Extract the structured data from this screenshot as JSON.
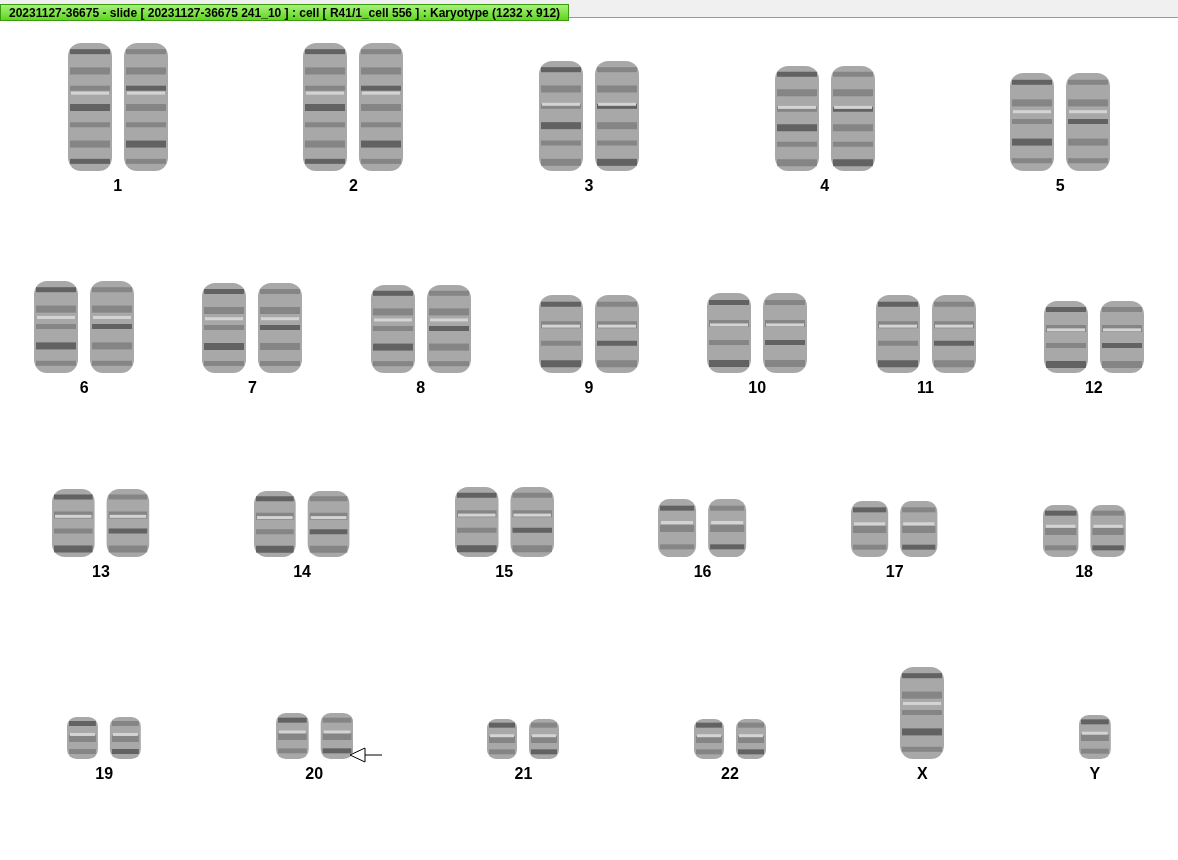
{
  "window": {
    "title": "20231127-36675 - slide [ 20231127-36675 241_10 ] : cell [ R41/1_cell 556 ] : Karyotype  (1232 x 912)"
  },
  "karyotype": {
    "rows": [
      [
        {
          "label": "1",
          "kind": "pair",
          "marked": false
        },
        {
          "label": "2",
          "kind": "pair",
          "marked": false
        },
        {
          "label": "3",
          "kind": "pair",
          "marked": false
        },
        {
          "label": "4",
          "kind": "pair",
          "marked": false
        },
        {
          "label": "5",
          "kind": "pair",
          "marked": false
        }
      ],
      [
        {
          "label": "6",
          "kind": "pair",
          "marked": false
        },
        {
          "label": "7",
          "kind": "pair",
          "marked": false
        },
        {
          "label": "8",
          "kind": "pair",
          "marked": false
        },
        {
          "label": "9",
          "kind": "pair",
          "marked": false
        },
        {
          "label": "10",
          "kind": "pair",
          "marked": false
        },
        {
          "label": "11",
          "kind": "pair",
          "marked": false
        },
        {
          "label": "12",
          "kind": "pair",
          "marked": false
        }
      ],
      [
        {
          "label": "13",
          "kind": "pair",
          "marked": false
        },
        {
          "label": "14",
          "kind": "pair",
          "marked": false
        },
        {
          "label": "15",
          "kind": "pair",
          "marked": false
        },
        {
          "label": "16",
          "kind": "pair",
          "marked": false
        },
        {
          "label": "17",
          "kind": "pair",
          "marked": false
        },
        {
          "label": "18",
          "kind": "pair",
          "marked": false
        }
      ],
      [
        {
          "label": "19",
          "kind": "pair",
          "marked": false
        },
        {
          "label": "20",
          "kind": "pair",
          "marked": true
        },
        {
          "label": "21",
          "kind": "pair",
          "marked": false
        },
        {
          "label": "22",
          "kind": "pair",
          "marked": false
        },
        {
          "label": "X",
          "kind": "single",
          "marked": false
        },
        {
          "label": "Y",
          "kind": "single",
          "marked": false
        }
      ]
    ]
  }
}
